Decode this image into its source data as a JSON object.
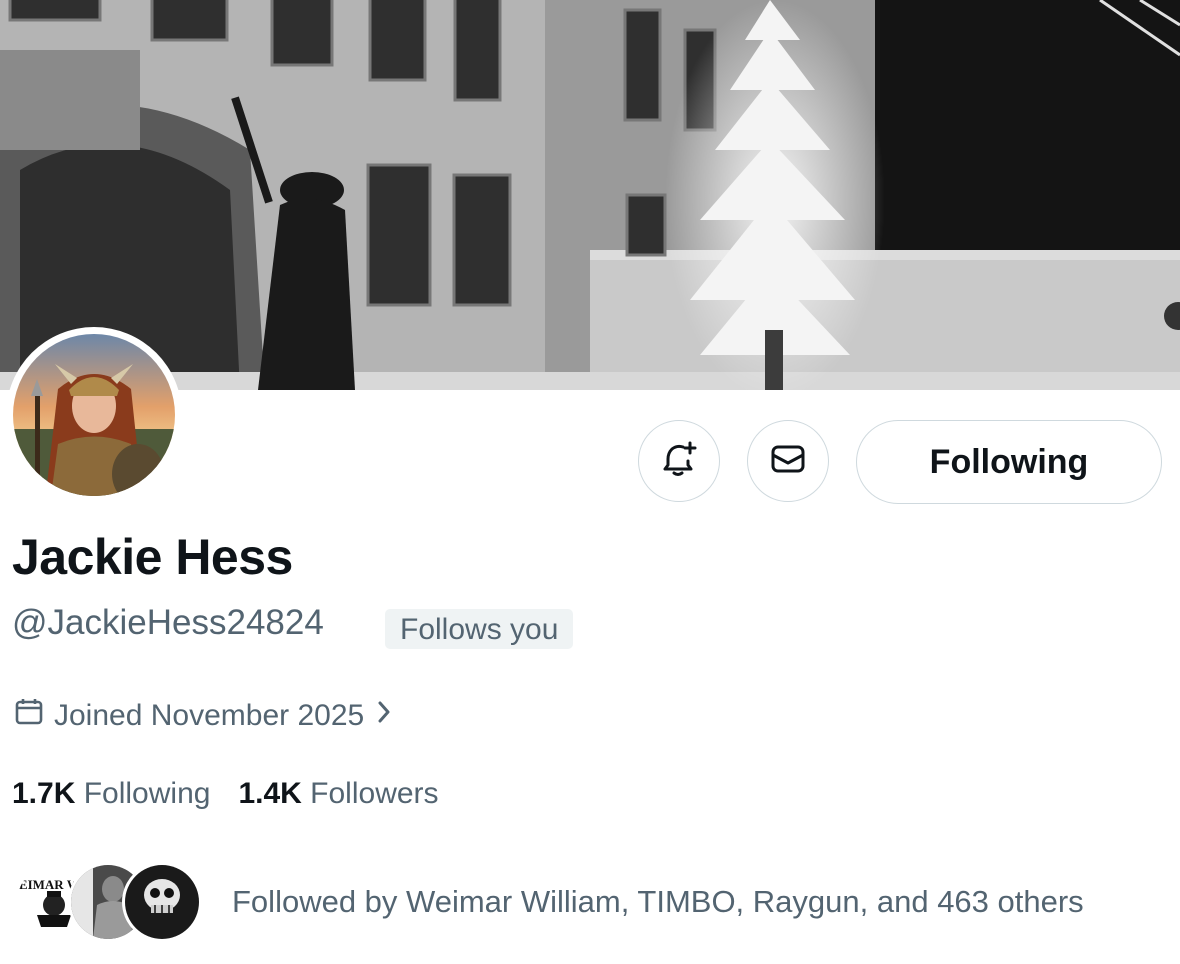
{
  "profile": {
    "name": "Jackie Hess",
    "handle": "@JackieHess24824",
    "follows_you_badge": "Follows you",
    "joined": "Joined November 2025",
    "following_count": "1.7K",
    "following_label": "Following",
    "followers_count": "1.4K",
    "followers_label": "Followers"
  },
  "actions": {
    "notify_icon": "bell-plus-icon",
    "message_icon": "envelope-icon",
    "follow_label": "Following"
  },
  "followed_by": {
    "avatars": [
      "WEIMAR WILL",
      "",
      ""
    ],
    "text": "Followed by Weimar William, TIMBO, Raygun, and 463 others"
  },
  "colors": {
    "text_primary": "#0f1419",
    "text_secondary": "#536471",
    "border": "#cfd9de",
    "badge_bg": "#eff3f4"
  }
}
